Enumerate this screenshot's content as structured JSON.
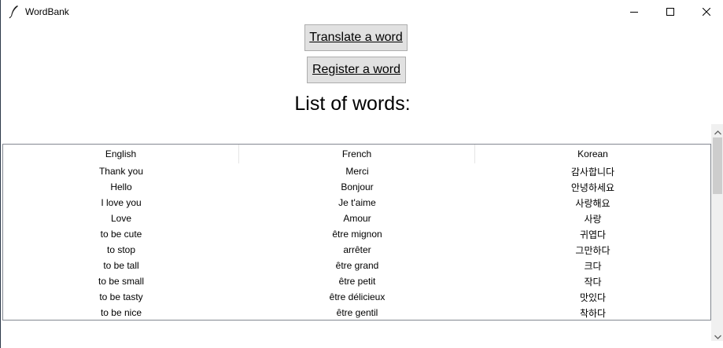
{
  "window": {
    "title": "WordBank",
    "icon": "feather-icon",
    "controls": [
      "minimize-icon",
      "maximize-icon",
      "close-icon"
    ]
  },
  "actions": {
    "translate_label": "Translate a word",
    "register_label": "Register a word"
  },
  "heading": "List of words:",
  "table": {
    "columns": [
      "English",
      "French",
      "Korean"
    ],
    "rows": [
      [
        "Thank you",
        "Merci",
        "감사합니다"
      ],
      [
        "Hello",
        "Bonjour",
        "안녕하세요"
      ],
      [
        "I love you",
        "Je t'aime",
        "사랑해요"
      ],
      [
        "Love",
        "Amour",
        "사랑"
      ],
      [
        "to be cute",
        "être mignon",
        "귀엽다"
      ],
      [
        "to stop",
        "arrêter",
        "그만하다"
      ],
      [
        "to be tall",
        "être grand",
        "크다"
      ],
      [
        "to be small",
        "être petit",
        "작다"
      ],
      [
        "to be tasty",
        "être délicieux",
        "맛있다"
      ],
      [
        "to be nice",
        "être gentil",
        "착하다"
      ]
    ]
  },
  "scrollbar": {
    "up_icon": "scroll-up-arrow-icon",
    "down_icon": "scroll-down-arrow-icon"
  }
}
